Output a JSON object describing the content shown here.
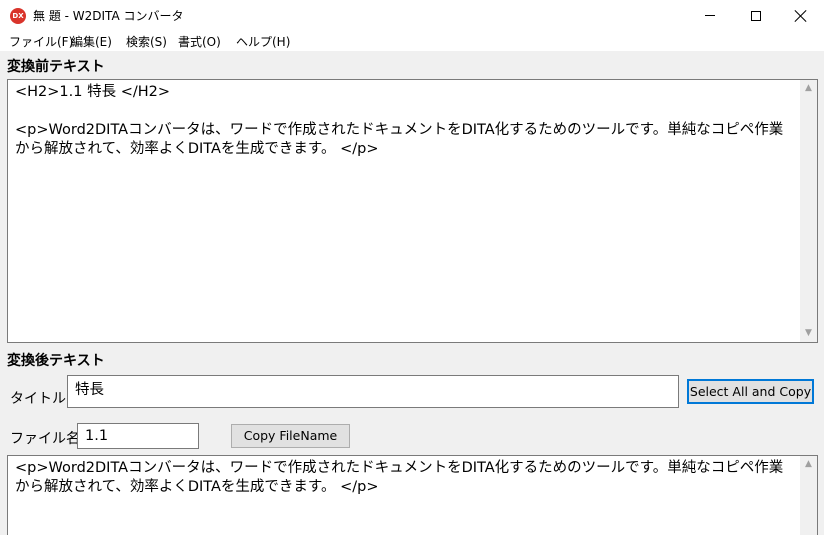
{
  "window": {
    "title": "無 題 - W2DITA コンバータ",
    "app_icon_text": "DX"
  },
  "menu": [
    "ファイル(F)",
    "編集(E)",
    "検索(S)",
    "書式(O)",
    "ヘルプ(H)"
  ],
  "before": {
    "label": "変換前テキスト",
    "text": "<H2>1.1 特長 </H2>\n\n<p>Word2DITAコンバータは、ワードで作成されたドキュメントをDITA化するためのツールです。単純なコピペ作業から解放されて、効率よくDITAを生成できます。 </p>"
  },
  "after": {
    "label": "変換後テキスト",
    "title_label": "タイトル",
    "title_value": "特長",
    "select_copy_label": "Select All and Copy",
    "filename_label": "ファイル名",
    "filename_value": "1.1",
    "copy_filename_label": "Copy FileName",
    "text": "<p>Word2DITAコンバータは、ワードで作成されたドキュメントをDITA化するためのツールです。単純なコピペ作業から解放されて、効率よくDITAを生成できます。 </p>"
  }
}
